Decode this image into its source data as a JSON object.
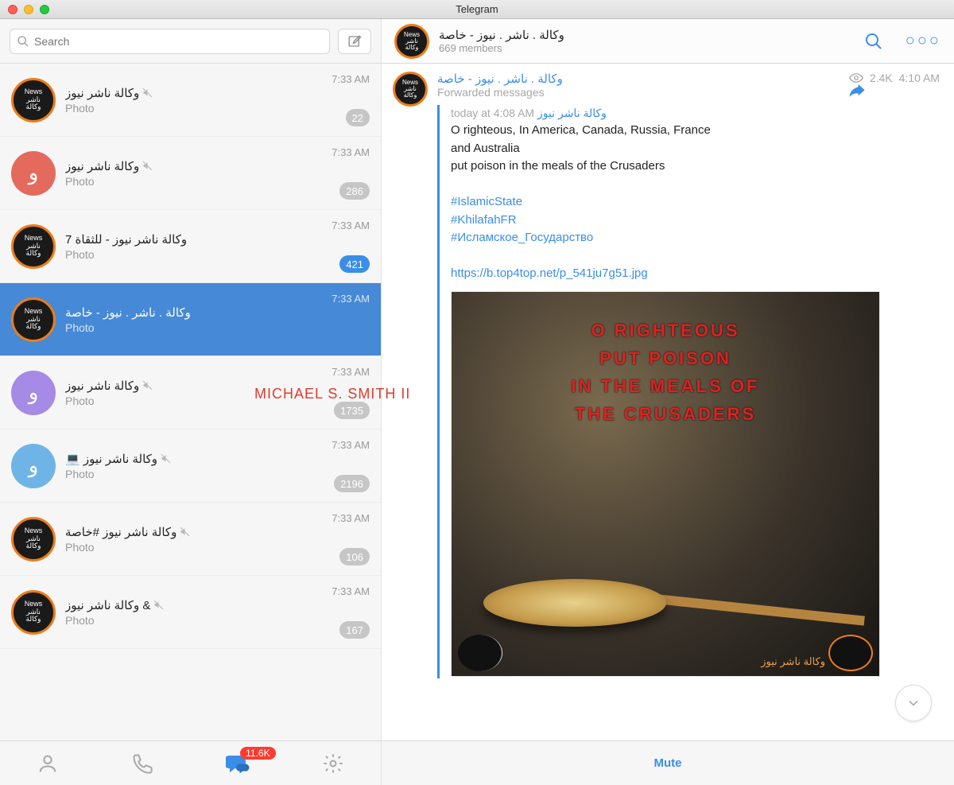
{
  "window": {
    "title": "Telegram"
  },
  "search": {
    "placeholder": "Search"
  },
  "header": {
    "channel_name": "وكالة . ناشر . نيوز - خاصة",
    "members": "669 members"
  },
  "chats": [
    {
      "name": "وكالة ناشر نيوز",
      "sub": "Photo",
      "time": "7:33 AM",
      "badge": "22",
      "badge_blue": false,
      "avatar": "news",
      "selected": false,
      "muted": true
    },
    {
      "name": "وكالة ناشر نيوز",
      "sub": "Photo",
      "time": "7:33 AM",
      "badge": "286",
      "badge_blue": false,
      "avatar": "letter",
      "color": "#e46a5e",
      "selected": false,
      "muted": true
    },
    {
      "name": "وكالة ناشر نيوز - للثقاة 7",
      "sub": "Photo",
      "time": "7:33 AM",
      "badge": "421",
      "badge_blue": true,
      "avatar": "news",
      "selected": false,
      "muted": false
    },
    {
      "name": "وكالة . ناشر . نيوز - خاصة",
      "sub": "Photo",
      "time": "7:33 AM",
      "badge": "",
      "badge_blue": false,
      "avatar": "news",
      "selected": true,
      "muted": false
    },
    {
      "name": "وكالة ناشر نيوز",
      "sub": "Photo",
      "time": "7:33 AM",
      "badge": "1735",
      "badge_blue": false,
      "avatar": "letter",
      "color": "#a58ae6",
      "selected": false,
      "muted": true
    },
    {
      "name": "💻 وكالة ناشر نيوز",
      "sub": "Photo",
      "time": "7:33 AM",
      "badge": "2196",
      "badge_blue": false,
      "avatar": "letter",
      "color": "#6fb4e6",
      "selected": false,
      "muted": true
    },
    {
      "name": "وكالة ناشر نيوز #خاصة",
      "sub": "Photo",
      "time": "7:33 AM",
      "badge": "106",
      "badge_blue": false,
      "avatar": "news",
      "selected": false,
      "muted": true
    },
    {
      "name": "وكالة ناشر نيوز &",
      "sub": "Photo",
      "time": "7:33 AM",
      "badge": "167",
      "badge_blue": false,
      "avatar": "news",
      "selected": false,
      "muted": true
    }
  ],
  "message": {
    "sender": "وكالة . ناشر . نيوز - خاصة",
    "views": "2.4K",
    "time": "4:10 AM",
    "forwarded": "Forwarded messages",
    "quote_author": "وكالة ناشر نيوز",
    "quote_time": "today at 4:08 AM",
    "body_line1": "O  righteous, In America, Canada, Russia, France",
    "body_line2": "and Australia",
    "body_line3": "put poison in the meals of the Crusaders",
    "hashtag1": "#IslamicState",
    "hashtag2": "#KhilafahFR",
    "hashtag3": "#Исламское_Государство",
    "link": "https://b.top4top.net/p_541ju7g51.jpg",
    "image_text_l1": "O  RIGHTEOUS",
    "image_text_l2": "PUT POISON",
    "image_text_l3": "IN THE MEALS OF",
    "image_text_l4": "THE CRUSADERS",
    "image_caption": "وكالة ناشر نيوز"
  },
  "footer": {
    "unread": "11.6K",
    "mute": "Mute"
  },
  "avatar_text": {
    "l1": "News",
    "l2": "ناشر",
    "l3": "وكالة",
    "letter": "و"
  },
  "watermark": "MICHAEL S. SMITH II"
}
